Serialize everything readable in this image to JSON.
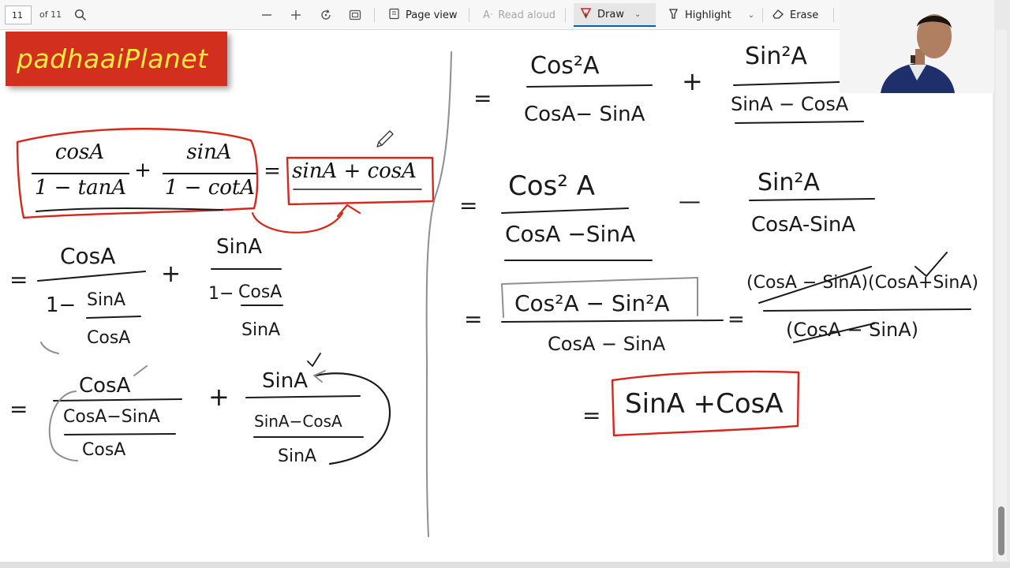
{
  "toolbar": {
    "page_number": "11",
    "page_total": "of 11",
    "page_view_label": "Page view",
    "read_aloud_label": "Read aloud",
    "draw_label": "Draw",
    "highlight_label": "Highlight",
    "erase_label": "Erase"
  },
  "logo": {
    "text": "padhaaiPlanet"
  },
  "typed_equation": {
    "frac1_num": "cosA",
    "frac1_den": "1 − tanA",
    "plus": "+",
    "frac2_num": "sinA",
    "frac2_den": "1 − cotA",
    "equals": "=",
    "rhs": "sinA + cosA"
  },
  "handwritten": {
    "step1": {
      "eq": "=",
      "num1": "CosA",
      "den1_a": "1−",
      "den1_num": "SinA",
      "den1_den": "CosA",
      "plus": "+",
      "num2": "SinA",
      "den2_a": "1−",
      "den2_num": "CosA",
      "den2_den": "SinA"
    },
    "step2": {
      "eq": "=",
      "num1": "CosA",
      "den1_num": "CosA−SinA",
      "den1_den": "CosA",
      "plus": "+",
      "num2": "SinA",
      "den2_num": "SinA−CosA",
      "den2_den": "SinA"
    },
    "step3": {
      "eq": "=",
      "num1": "Cos²A",
      "den1": "CosA− SinA",
      "plus": "+",
      "num2": "Sin²A",
      "den2": "SinA − CosA"
    },
    "step4": {
      "eq": "=",
      "num1": "Cos² A",
      "den1": "CosA −SinA",
      "minus": "—",
      "num2": "Sin²A",
      "den2": "CosA-SinA"
    },
    "step5": {
      "eq": "=",
      "num": "Cos²A − Sin²A",
      "den": "CosA − SinA",
      "eq2": "=",
      "num2": "(CosA − SinA)(CosA+SinA)",
      "den2": "(CosA − SinA)"
    },
    "final": {
      "eq": "=",
      "answer": "SinA +CosA"
    }
  },
  "colors": {
    "logo_bg": "#d32f1e",
    "logo_text": "#ffec3d",
    "ink_red": "#d8261b",
    "ink_black": "#1a1a1a",
    "ink_gray": "#8f8f8f"
  }
}
